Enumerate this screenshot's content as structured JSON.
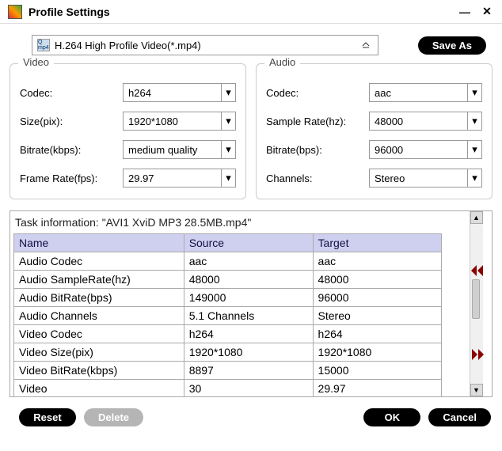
{
  "window": {
    "title": "Profile Settings"
  },
  "profile": {
    "selected": "H.264 High Profile Video(*.mp4)",
    "save_as": "Save As",
    "icon_tag": "Q mp4"
  },
  "video": {
    "legend": "Video",
    "codec_label": "Codec:",
    "codec_value": "h264",
    "size_label": "Size(pix):",
    "size_value": "1920*1080",
    "bitrate_label": "Bitrate(kbps):",
    "bitrate_value": "medium quality",
    "fps_label": "Frame Rate(fps):",
    "fps_value": "29.97"
  },
  "audio": {
    "legend": "Audio",
    "codec_label": "Codec:",
    "codec_value": "aac",
    "sr_label": "Sample Rate(hz):",
    "sr_value": "48000",
    "bitrate_label": "Bitrate(bps):",
    "bitrate_value": "96000",
    "ch_label": "Channels:",
    "ch_value": "Stereo"
  },
  "task": {
    "info": "Task information: \"AVI1 XviD MP3 28.5MB.mp4\"",
    "headers": {
      "name": "Name",
      "source": "Source",
      "target": "Target"
    },
    "rows": [
      {
        "name": "Audio Codec",
        "source": "aac",
        "target": "aac"
      },
      {
        "name": "Audio SampleRate(hz)",
        "source": "48000",
        "target": "48000"
      },
      {
        "name": "Audio BitRate(bps)",
        "source": "149000",
        "target": "96000"
      },
      {
        "name": "Audio Channels",
        "source": "5.1 Channels",
        "target": "Stereo"
      },
      {
        "name": "Video Codec",
        "source": "h264",
        "target": "h264"
      },
      {
        "name": "Video Size(pix)",
        "source": "1920*1080",
        "target": "1920*1080"
      },
      {
        "name": "Video BitRate(kbps)",
        "source": "8897",
        "target": "15000"
      },
      {
        "name": "Video",
        "source": "30",
        "target": "29.97"
      }
    ]
  },
  "buttons": {
    "reset": "Reset",
    "delete": "Delete",
    "ok": "OK",
    "cancel": "Cancel"
  }
}
